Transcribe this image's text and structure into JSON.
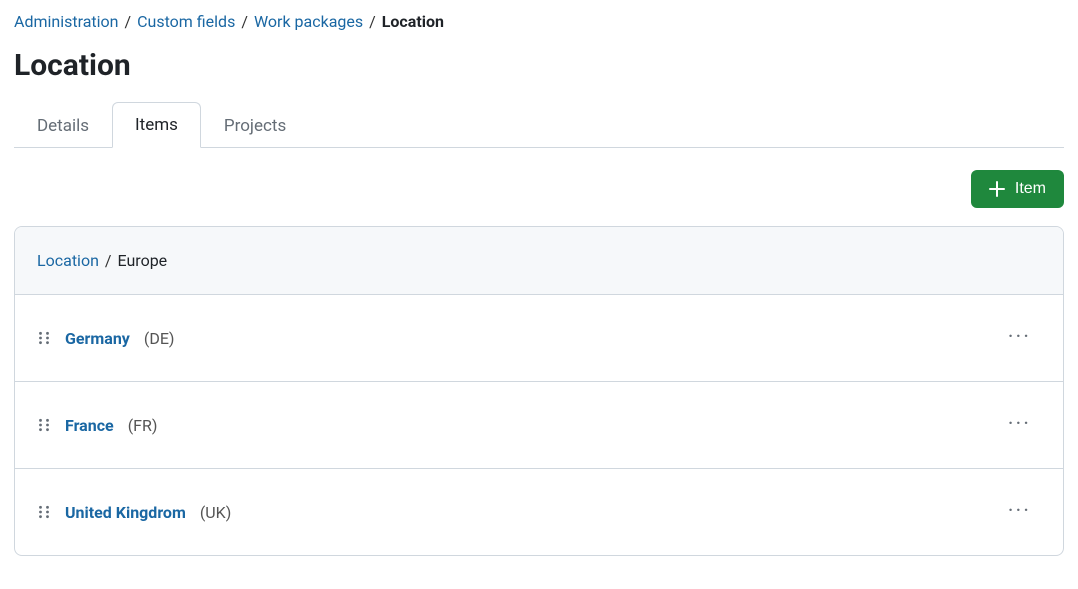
{
  "breadcrumb": {
    "items": [
      {
        "label": "Administration"
      },
      {
        "label": "Custom fields"
      },
      {
        "label": "Work packages"
      }
    ],
    "current": "Location"
  },
  "page_title": "Location",
  "tabs": [
    {
      "label": "Details",
      "active": false
    },
    {
      "label": "Items",
      "active": true
    },
    {
      "label": "Projects",
      "active": false
    }
  ],
  "toolbar": {
    "add_item_label": "Item"
  },
  "panel": {
    "breadcrumb_root": "Location",
    "breadcrumb_current": "Europe",
    "items": [
      {
        "name": "Germany",
        "code": "(DE)"
      },
      {
        "name": "France",
        "code": "(FR)"
      },
      {
        "name": "United Kingdrom",
        "code": "(UK)"
      }
    ]
  }
}
